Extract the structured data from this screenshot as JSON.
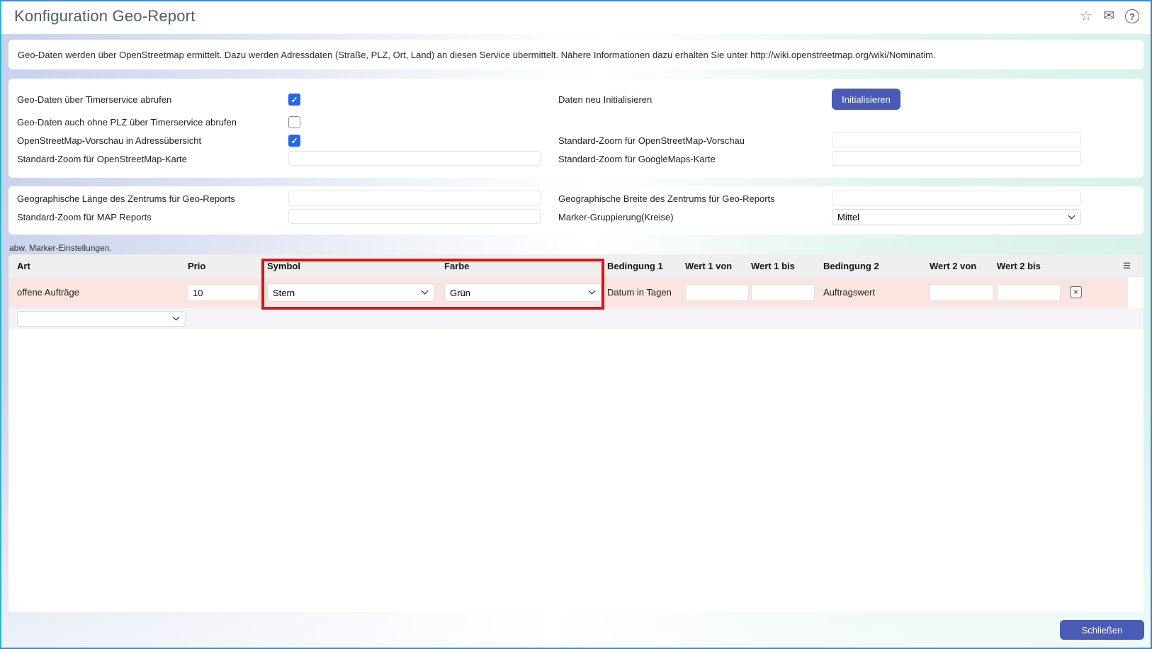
{
  "header": {
    "title": "Konfiguration Geo-Report"
  },
  "icons": {
    "star": "☆",
    "mail": "✉",
    "help": "?",
    "check": "✓",
    "menu": "≡",
    "delete": "×"
  },
  "info_banner": {
    "text": "Geo-Daten werden über OpenStreetmap ermittelt. Dazu werden Adressdaten (Straße, PLZ, Ort, Land) an diesen Service übermittelt. Nähere Informationen dazu erhalten Sie unter http://wiki.openstreetmap.org/wiki/Nominatim."
  },
  "general_settings": {
    "left": [
      {
        "label": "Geo-Daten über Timerservice abrufen",
        "type": "checkbox",
        "checked": true
      },
      {
        "label": "Geo-Daten auch ohne PLZ über Timerservice abrufen",
        "type": "checkbox",
        "checked": false
      },
      {
        "label": "OpenStreetMap-Vorschau in Adressübersicht",
        "type": "checkbox",
        "checked": true
      },
      {
        "label": "Standard-Zoom für OpenStreetMap-Karte",
        "type": "text",
        "value": ""
      }
    ],
    "right": [
      {
        "label": "Daten neu Initialisieren",
        "type": "button",
        "button_label": "Initialisieren"
      },
      {
        "label": "Standard-Zoom für OpenStreetMap-Vorschau",
        "type": "text",
        "value": ""
      },
      {
        "label": "Standard-Zoom für GoogleMaps-Karte",
        "type": "text",
        "value": ""
      }
    ]
  },
  "geo_settings": {
    "left": [
      {
        "label": "Geographische Länge des Zentrums für Geo-Reports",
        "type": "text",
        "value": ""
      },
      {
        "label": "Standard-Zoom für MAP Reports",
        "type": "text",
        "value": ""
      }
    ],
    "right": [
      {
        "label": "Geographische Breite des Zentrums für Geo-Reports",
        "type": "text",
        "value": ""
      },
      {
        "label": "Marker-Gruppierung(Kreise)",
        "type": "select",
        "value": "Mittel"
      }
    ]
  },
  "marker_table": {
    "caption": "abw. Marker-Einstellungen.",
    "columns": [
      "Art",
      "Prio",
      "Symbol",
      "Farbe",
      "Bedingung 1",
      "Wert 1 von",
      "Wert 1 bis",
      "Bedingung 2",
      "Wert 2 von",
      "Wert 2 bis"
    ],
    "row": {
      "art": "offene Aufträge",
      "prio": "10",
      "symbol": "Stern",
      "farbe": "Grün",
      "bedingung1": "Datum in Tagen",
      "wert1von": "",
      "wert1bis": "",
      "bedingung2": "Auftragswert",
      "wert2von": "",
      "wert2bis": ""
    }
  },
  "footer": {
    "close_label": "Schließen"
  },
  "colors": {
    "accent_button": "#4a5bb5",
    "checkbox_checked": "#2468e5",
    "highlight_box": "#e01212",
    "row_highlight": "#fbe5e1"
  }
}
